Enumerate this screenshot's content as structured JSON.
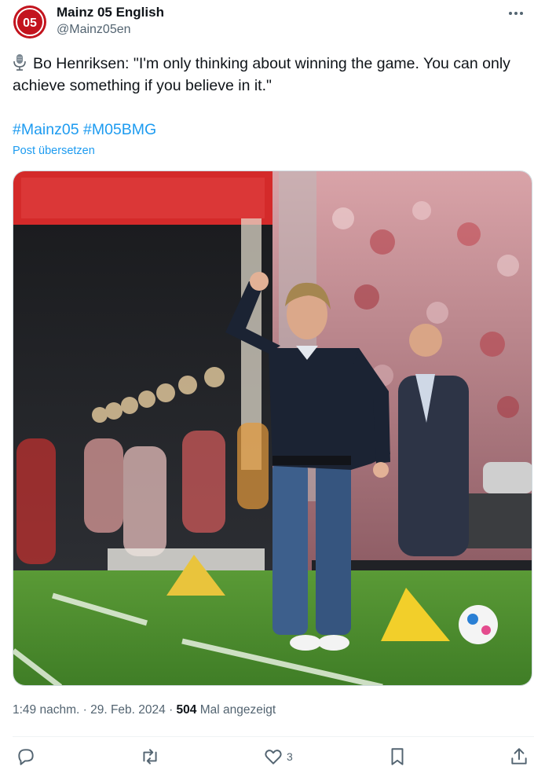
{
  "author": {
    "display_name": "Mainz 05 English",
    "handle": "@Mainz05en",
    "brand_color": "#c3141e"
  },
  "tweet": {
    "text": "Bo Henriksen: \"I'm only thinking about winning the game. You can only achieve something if you believe in it.\"",
    "leading_icon": "microphone-icon",
    "hashtags": [
      "#Mainz05",
      "#M05BMG"
    ],
    "translate_label": "Post übersetzen"
  },
  "media": {
    "scoreboard_colors": {
      "banner": "#d42a2a",
      "pitch": "#4e8a2e",
      "jersey": "#1b2333",
      "jeans": "#3d5f8c"
    }
  },
  "meta": {
    "time": "1:49 nachm.",
    "date": "29. Feb. 2024",
    "views_count": "504",
    "views_label": "Mal angezeigt"
  },
  "actions": {
    "reply_icon": "reply-icon",
    "repost_icon": "repost-icon",
    "like_icon": "heart-icon",
    "like_count": "3",
    "bookmark_icon": "bookmark-icon",
    "share_icon": "share-icon"
  }
}
